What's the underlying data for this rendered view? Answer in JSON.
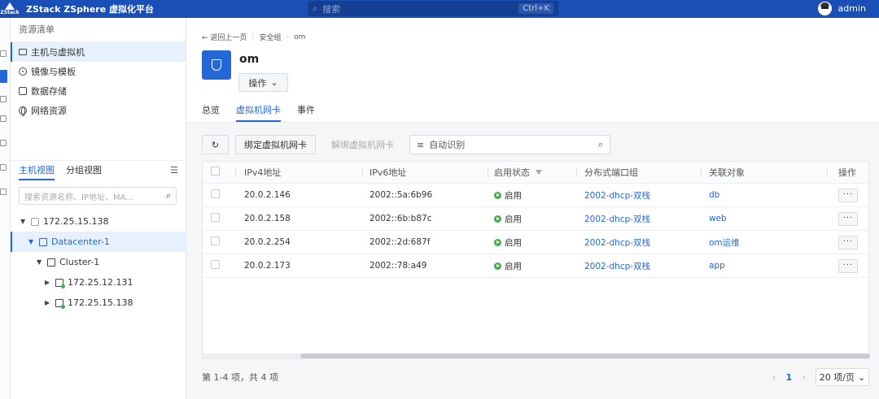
{
  "app": {
    "logo_text": "ZStack",
    "title": "ZStack ZSphere 虚拟化平台"
  },
  "search": {
    "placeholder": "搜索",
    "shortcut": "Ctrl+K"
  },
  "user": {
    "name": "admin"
  },
  "sidebar": {
    "header": "资源清单",
    "items": [
      {
        "label": "主机与虚拟机",
        "icon": "monitor-icon"
      },
      {
        "label": "镜像与模板",
        "icon": "disc-icon"
      },
      {
        "label": "数据存储",
        "icon": "database-icon"
      },
      {
        "label": "网络资源",
        "icon": "globe-icon"
      }
    ],
    "view_tabs": [
      "主机视图",
      "分组视图"
    ],
    "tree_search_placeholder": "搜索资源名称、IP地址、MA...",
    "tree": [
      {
        "label": "172.25.15.138",
        "icon": "group-icon"
      },
      {
        "label": "Datacenter-1",
        "icon": "datacenter-icon"
      },
      {
        "label": "Cluster-1",
        "icon": "cluster-icon"
      },
      {
        "label": "172.25.12.131",
        "icon": "host-icon"
      },
      {
        "label": "172.25.15.138",
        "icon": "host-icon"
      }
    ]
  },
  "breadcrumb": {
    "back": "← 返回上一页",
    "parent": "安全组",
    "current": "om"
  },
  "page": {
    "title": "om",
    "ops_label": "操作"
  },
  "tabs": [
    "总览",
    "虚拟机网卡",
    "事件"
  ],
  "toolbar": {
    "bind_label": "绑定虚拟机网卡",
    "unbind_label": "解绑虚拟机网卡",
    "filter_label": "自动识别"
  },
  "table": {
    "headers": [
      "IPv4地址",
      "IPv6地址",
      "启用状态",
      "分布式端口组",
      "关联对象",
      "操作"
    ],
    "rows": [
      {
        "ipv4": "20.0.2.146",
        "ipv6": "2002::5a:6b96",
        "status": "启用",
        "portgroup": "2002-dhcp-双栈",
        "object": "db"
      },
      {
        "ipv4": "20.0.2.158",
        "ipv6": "2002::6b:b87c",
        "status": "启用",
        "portgroup": "2002-dhcp-双栈",
        "object": "web"
      },
      {
        "ipv4": "20.0.2.254",
        "ipv6": "2002::2d:687f",
        "status": "启用",
        "portgroup": "2002-dhcp-双栈",
        "object": "om运维"
      },
      {
        "ipv4": "20.0.2.173",
        "ipv6": "2002::78:a49",
        "status": "启用",
        "portgroup": "2002-dhcp-双栈",
        "object": "app"
      }
    ],
    "more_label": "···"
  },
  "footer": {
    "summary": "第 1-4 项，共 4 项",
    "page": "1",
    "page_size": "20 项/页"
  },
  "colors": {
    "topbar": "#1a4fb8",
    "accent": "#2468d8",
    "enabled": "#3eb34a"
  }
}
